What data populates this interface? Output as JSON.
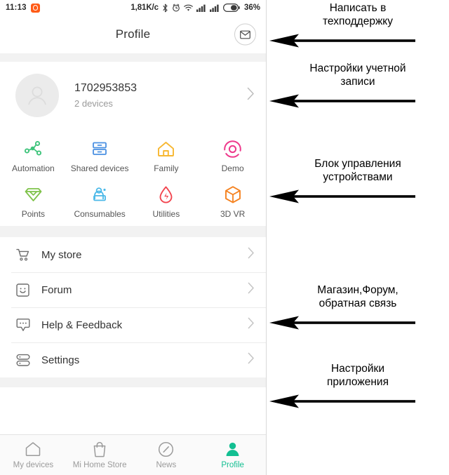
{
  "status_bar": {
    "time": "11:13",
    "app_icon": "notification-app-icon",
    "network_speed": "1,81K/c",
    "icons": [
      "bluetooth-icon",
      "alarm-icon",
      "wifi-icon",
      "signal-icon",
      "signal-icon",
      "battery-icon"
    ],
    "battery_percent": "36%"
  },
  "header": {
    "title": "Profile",
    "mail_icon": "envelope-icon"
  },
  "account": {
    "avatar_icon": "person-avatar-icon",
    "user_id": "1702953853",
    "devices": "2 devices",
    "chevron": "chevron-right-icon"
  },
  "grid": {
    "items": [
      {
        "label": "Automation",
        "icon": "automation-nodes-icon",
        "color": "#3ec47b"
      },
      {
        "label": "Shared devices",
        "icon": "shared-devices-icon",
        "color": "#4a90e2"
      },
      {
        "label": "Family",
        "icon": "home-icon",
        "color": "#f7b731"
      },
      {
        "label": "Demo",
        "icon": "demo-target-icon",
        "color": "#ee3a8c"
      },
      {
        "label": "Points",
        "icon": "diamond-icon",
        "color": "#7fc24a"
      },
      {
        "label": "Consumables",
        "icon": "consumables-icon",
        "color": "#4ab8e8"
      },
      {
        "label": "Utilities",
        "icon": "droplet-bolt-icon",
        "color": "#f2444e"
      },
      {
        "label": "3D VR",
        "icon": "cube-icon",
        "color": "#f58220"
      }
    ]
  },
  "menu": {
    "items": [
      {
        "label": "My store",
        "icon": "shopping-cart-icon"
      },
      {
        "label": "Forum",
        "icon": "smiley-square-icon"
      },
      {
        "label": "Help & Feedback",
        "icon": "chat-bubble-icon"
      },
      {
        "label": "Settings",
        "icon": "server-stack-icon"
      }
    ]
  },
  "tabbar": {
    "active_color": "#13bf92",
    "items": [
      {
        "label": "My devices",
        "icon": "home-outline-icon",
        "active": false
      },
      {
        "label": "Mi Home Store",
        "icon": "shopping-bag-icon",
        "active": false
      },
      {
        "label": "News",
        "icon": "compass-icon",
        "active": false
      },
      {
        "label": "Profile",
        "icon": "person-filled-icon",
        "active": true
      }
    ]
  },
  "annotations": [
    {
      "text": "Написать в\nтехподдержку",
      "arrow": "left-arrow-icon"
    },
    {
      "text": "Настройки учетной\nзаписи",
      "arrow": "left-arrow-icon"
    },
    {
      "text": "Блок управления\nустройствами",
      "arrow": "left-arrow-icon"
    },
    {
      "text": "Магазин,Форум,\nобратная связь",
      "arrow": "left-arrow-icon"
    },
    {
      "text": "Настройки\nприложения",
      "arrow": "left-arrow-icon"
    }
  ]
}
